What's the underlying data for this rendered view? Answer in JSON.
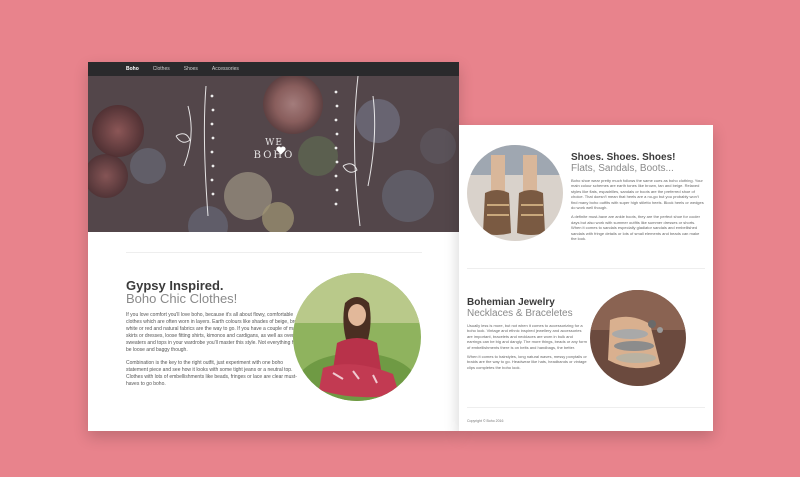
{
  "colors": {
    "background": "#e8838c",
    "navbar": "#2a2a2c",
    "heading": "#3a3a3a",
    "subheading": "#8a8a8a"
  },
  "nav": {
    "brand": "Boho",
    "items": [
      "Clothes",
      "Shoes",
      "Accessories"
    ]
  },
  "hero": {
    "logo_line1": "WE",
    "logo_line2": "BOHO"
  },
  "section_left": {
    "title": "Gypsy Inspired.",
    "subtitle": "Boho Chic Clothes!",
    "paragraph1": "If you love comfort you'll love boho, because it's all about flowy, comfortable clothes which are often worn in layers. Earth colours like shades of beige, brown, white or red and natural fabrics are the way to go. If you have a couple of maxi skirts or dresses, loose fitting shirts, kimonos and cardigans, as well as oversized sweaters and tops in your wardrobe you'll master this style. Not everything has to be loose and baggy though.",
    "paragraph2": "Combination is the key to the right outfit, just experiment with one boho statement piece and see how it looks with some tight jeans or a neutral top. Clothes with lots of embellishments like beads, fringes or lace are clear must-haves to go boho."
  },
  "section_shoes": {
    "title": "Shoes. Shoes. Shoes!",
    "subtitle": "Flats, Sandals, Boots...",
    "paragraph1": "Boho shoe wear pretty much follows the same cues as boho clothing. Your main colour schemes are earth tones like brown, tan and beige. Relaxed styles like flats, espadrilles, sandals or boots are the preferred shoe of choice. That doesn't mean that heels are a no-go but you probably won't find many boho outfits with super high stiletto heels. Block heels or wedges do work well though.",
    "paragraph2": "A definite must-have are ankle boots, they are the perfect shoe for cooler days but also work with summer outfits like summer dresses or shorts. When it comes to sandals especially gladiator sandals and embellished sandals with fringe details or lots of small elements and beads can make the look."
  },
  "section_jewelry": {
    "title": "Bohemian Jewelry",
    "subtitle": "Necklaces & Braceletes",
    "paragraph1": "Usually less is more, but not when it comes to accessorizing for a boho look. Vintage and ethnic inspired jewellery and accessories are important, bracelets and necklaces are worn in bulk and earrings can be big and dangly. The more things, beads or any form of embellishments there is on belts and handbags, the better.",
    "paragraph2": "When it comes to hairstyles, long natural waves, messy ponytails or braids are the way to go. Headwear like hats, headbands or vintage clips completes the boho look."
  },
  "footer": {
    "copyright": "Copyright © Boho 2016"
  }
}
